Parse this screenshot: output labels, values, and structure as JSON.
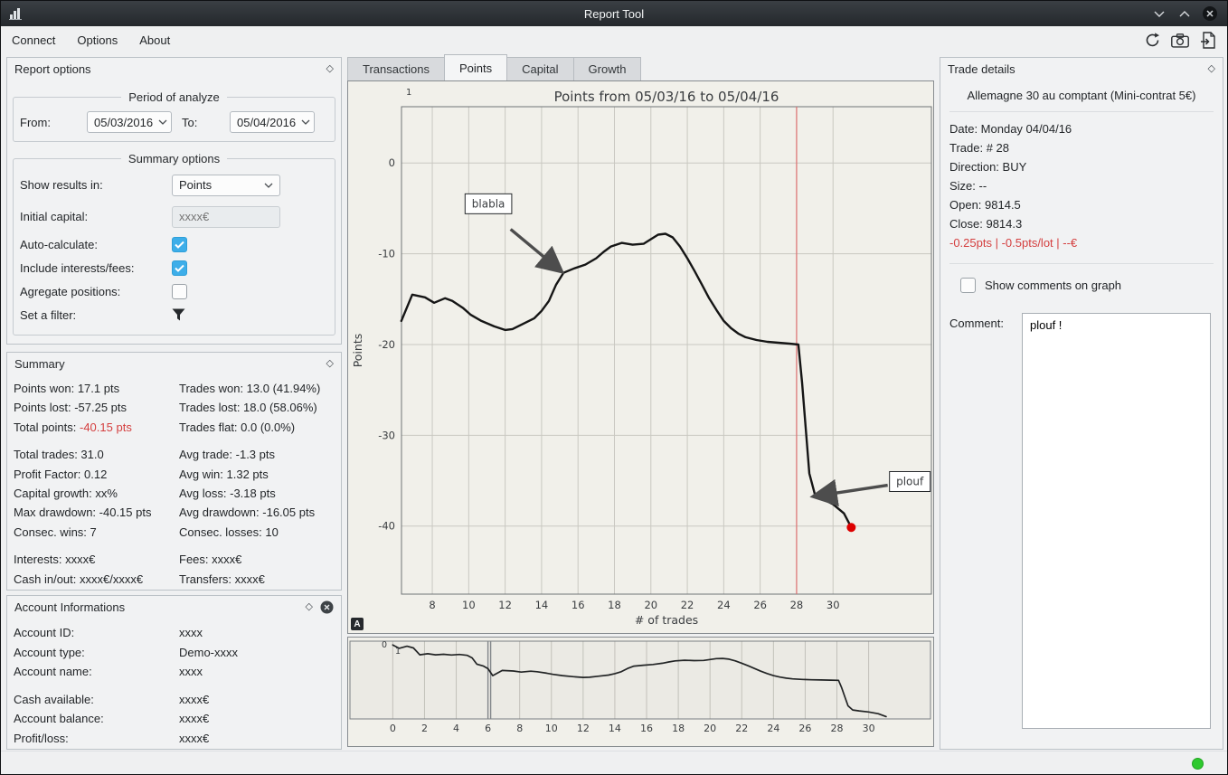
{
  "window": {
    "title": "Report Tool"
  },
  "menu": {
    "items": [
      "Connect",
      "Options",
      "About"
    ]
  },
  "tabs": {
    "items": [
      {
        "label": "Transactions",
        "active": false
      },
      {
        "label": "Points",
        "active": true
      },
      {
        "label": "Capital",
        "active": false
      },
      {
        "label": "Growth",
        "active": false
      }
    ]
  },
  "report_options": {
    "title": "Report options",
    "period": {
      "legend": "Period of analyze",
      "from_label": "From:",
      "from_value": "05/03/2016",
      "to_label": "To:",
      "to_value": "05/04/2016"
    },
    "options": {
      "legend": "Summary options",
      "show_results_label": "Show results in:",
      "show_results_value": "Points",
      "initial_capital_label": "Initial capital:",
      "initial_capital_placeholder": "xxxx€",
      "auto_calculate_label": "Auto-calculate:",
      "auto_calculate_checked": true,
      "include_fees_label": "Include interests/fees:",
      "include_fees_checked": true,
      "aggregate_label": "Agregate positions:",
      "aggregate_checked": false,
      "filter_label": "Set a filter:"
    }
  },
  "summary": {
    "title": "Summary",
    "groups": [
      {
        "rows": [
          {
            "left": "Points won: 17.1 pts",
            "right": "Trades won: 13.0 (41.94%)"
          },
          {
            "left": "Points lost: -57.25 pts",
            "right": "Trades lost: 18.0 (58.06%)"
          },
          {
            "left_label": "Total points: ",
            "left_value": "-40.15 pts",
            "right": "Trades flat: 0.0 (0.0%)"
          }
        ]
      },
      {
        "rows": [
          {
            "left": "Total trades: 31.0",
            "right": "Avg trade: -1.3 pts"
          },
          {
            "left": "Profit Factor: 0.12",
            "right": "Avg win: 1.32 pts"
          },
          {
            "left": "Capital growth: xx%",
            "right": "Avg loss: -3.18 pts"
          },
          {
            "left": "Max drawdown: -40.15 pts",
            "right": "Avg drawdown: -16.05 pts"
          },
          {
            "left": "Consec. wins: 7",
            "right": "Consec. losses: 10"
          }
        ]
      },
      {
        "rows": [
          {
            "left": "Interests: xxxx€",
            "right": "Fees: xxxx€"
          },
          {
            "left": "Cash in/out: xxxx€/xxxx€",
            "right": "Transfers: xxxx€"
          }
        ]
      }
    ]
  },
  "account_info": {
    "title": "Account Informations",
    "rows": [
      {
        "label": "Account ID:",
        "value": "xxxx"
      },
      {
        "label": "Account type:",
        "value": "Demo-xxxx"
      },
      {
        "label": "Account name:",
        "value": "xxxx"
      },
      {
        "label": "Cash available:",
        "value": "xxxx€"
      },
      {
        "label": "Account balance:",
        "value": "xxxx€"
      },
      {
        "label": "Profit/loss:",
        "value": "xxxx€"
      }
    ]
  },
  "trade_details": {
    "title": "Trade details",
    "instrument": "Allemagne 30 au comptant (Mini-contrat 5€)",
    "fields": [
      "Date: Monday 04/04/16",
      "Trade: # 28",
      "Direction: BUY",
      "Size: --",
      "Open: 9814.5",
      "Close: 9814.3"
    ],
    "result": "-0.25pts | -0.5pts/lot | --€",
    "show_comments_label": "Show comments on graph",
    "show_comments_checked": false,
    "comment_label": "Comment:",
    "comment_value": "plouf !"
  },
  "main_chart_badge": "A",
  "colors": {
    "accent": "#3daee9",
    "negative_text": "#d43f3f",
    "line": "#151515",
    "marker": "#dd0000",
    "vline": "#dd7070",
    "grid": "#c9c8c1",
    "status_ok": "#2ec92e"
  },
  "chart_data": [
    {
      "type": "line",
      "title": "Points from 05/03/16 to 05/04/16",
      "xlabel": "# of trades",
      "ylabel": "Points",
      "xlim": [
        6.31,
        35.4
      ],
      "ylim": [
        -47.5,
        6.2
      ],
      "xticks": [
        8,
        10,
        12,
        14,
        16,
        18,
        20,
        22,
        24,
        26,
        28,
        30
      ],
      "yticks": [
        0,
        -10,
        -20,
        -30,
        -40
      ],
      "corner_label": "1",
      "vline": {
        "x": 28,
        "color": "#dd7070"
      },
      "marker": {
        "x": 31,
        "y": -40.15,
        "color": "#dd0000"
      },
      "series": [
        {
          "name": "cumulated points",
          "points": [
            [
              6.3,
              -17.4
            ],
            [
              6.9,
              -14.5
            ],
            [
              7.6,
              -14.8
            ],
            [
              8.1,
              -15.4
            ],
            [
              8.7,
              -14.9
            ],
            [
              9.1,
              -15.2
            ],
            [
              9.7,
              -16.0
            ],
            [
              10.1,
              -16.7
            ],
            [
              10.7,
              -17.4
            ],
            [
              11.4,
              -18.0
            ],
            [
              12.0,
              -18.4
            ],
            [
              12.4,
              -18.3
            ],
            [
              13.0,
              -17.7
            ],
            [
              13.6,
              -17.1
            ],
            [
              14.0,
              -16.3
            ],
            [
              14.4,
              -15.2
            ],
            [
              14.8,
              -13.4
            ],
            [
              15.2,
              -12.1
            ],
            [
              15.8,
              -11.6
            ],
            [
              16.4,
              -11.2
            ],
            [
              17.0,
              -10.5
            ],
            [
              17.4,
              -9.8
            ],
            [
              17.8,
              -9.2
            ],
            [
              18.4,
              -8.8
            ],
            [
              19.0,
              -9.0
            ],
            [
              19.6,
              -8.9
            ],
            [
              20.0,
              -8.4
            ],
            [
              20.4,
              -7.9
            ],
            [
              20.8,
              -7.8
            ],
            [
              21.2,
              -8.2
            ],
            [
              21.6,
              -9.2
            ],
            [
              22.0,
              -10.5
            ],
            [
              22.4,
              -11.9
            ],
            [
              22.8,
              -13.4
            ],
            [
              23.2,
              -14.9
            ],
            [
              23.6,
              -16.2
            ],
            [
              24.0,
              -17.4
            ],
            [
              24.4,
              -18.2
            ],
            [
              24.8,
              -18.8
            ],
            [
              25.2,
              -19.2
            ],
            [
              25.8,
              -19.5
            ],
            [
              26.4,
              -19.7
            ],
            [
              27.0,
              -19.8
            ],
            [
              27.6,
              -19.9
            ],
            [
              28.1,
              -20.0
            ],
            [
              28.3,
              -24.2
            ],
            [
              28.5,
              -29.2
            ],
            [
              28.7,
              -34.2
            ],
            [
              29.0,
              -36.5
            ],
            [
              29.4,
              -37.0
            ],
            [
              30.0,
              -37.6
            ],
            [
              30.6,
              -38.6
            ],
            [
              31.0,
              -40.15
            ]
          ]
        }
      ],
      "annotations": [
        {
          "text": "blabla",
          "box_xy": [
            9.8,
            -3.4
          ],
          "arrow_from": [
            12.3,
            -7.3
          ],
          "arrow_to": [
            15.0,
            -11.8
          ]
        },
        {
          "text": "plouf",
          "box_xy": [
            33.1,
            -34.0
          ],
          "arrow_from": [
            33.0,
            -35.5
          ],
          "arrow_to": [
            29.05,
            -36.7
          ]
        }
      ]
    },
    {
      "type": "line",
      "title": "",
      "xlabel": "",
      "ylabel": "",
      "xlim": [
        -2.7,
        33.9
      ],
      "ylim": [
        -41.5,
        1.8
      ],
      "xticks": [
        0,
        2,
        4,
        6,
        8,
        10,
        12,
        14,
        16,
        18,
        20,
        22,
        24,
        26,
        28,
        30
      ],
      "yticks": [],
      "corner_labels": [
        "0",
        "1"
      ],
      "handles": [
        6.0,
        6.17
      ],
      "series": [
        {
          "name": "cumulated points (overview)",
          "points": [
            [
              0.0,
              -0.3
            ],
            [
              0.4,
              -2.2
            ],
            [
              0.9,
              -1.0
            ],
            [
              1.3,
              -2.0
            ],
            [
              1.7,
              -5.8
            ],
            [
              2.2,
              -5.2
            ],
            [
              2.7,
              -5.8
            ],
            [
              3.2,
              -5.5
            ],
            [
              3.7,
              -5.9
            ],
            [
              4.2,
              -5.6
            ],
            [
              4.7,
              -6.1
            ],
            [
              5.0,
              -7.5
            ],
            [
              5.3,
              -11.0
            ],
            [
              5.7,
              -12.0
            ],
            [
              6.0,
              -13.5
            ],
            [
              6.3,
              -17.4
            ],
            [
              6.9,
              -14.5
            ],
            [
              7.6,
              -14.8
            ],
            [
              8.1,
              -15.4
            ],
            [
              8.7,
              -14.9
            ],
            [
              9.1,
              -15.2
            ],
            [
              9.7,
              -16.0
            ],
            [
              10.1,
              -16.7
            ],
            [
              10.7,
              -17.4
            ],
            [
              11.4,
              -18.0
            ],
            [
              12.0,
              -18.4
            ],
            [
              12.4,
              -18.3
            ],
            [
              13.0,
              -17.7
            ],
            [
              13.6,
              -17.1
            ],
            [
              14.0,
              -16.3
            ],
            [
              14.4,
              -15.2
            ],
            [
              14.8,
              -13.4
            ],
            [
              15.2,
              -12.1
            ],
            [
              15.8,
              -11.6
            ],
            [
              16.4,
              -11.2
            ],
            [
              17.0,
              -10.5
            ],
            [
              17.4,
              -9.8
            ],
            [
              17.8,
              -9.2
            ],
            [
              18.4,
              -8.8
            ],
            [
              19.0,
              -9.0
            ],
            [
              19.6,
              -8.9
            ],
            [
              20.0,
              -8.4
            ],
            [
              20.4,
              -7.9
            ],
            [
              20.8,
              -7.8
            ],
            [
              21.2,
              -8.2
            ],
            [
              21.6,
              -9.2
            ],
            [
              22.0,
              -10.5
            ],
            [
              22.4,
              -11.9
            ],
            [
              22.8,
              -13.4
            ],
            [
              23.2,
              -14.9
            ],
            [
              23.6,
              -16.2
            ],
            [
              24.0,
              -17.4
            ],
            [
              24.4,
              -18.2
            ],
            [
              24.8,
              -18.8
            ],
            [
              25.2,
              -19.2
            ],
            [
              25.8,
              -19.5
            ],
            [
              26.4,
              -19.7
            ],
            [
              27.0,
              -19.8
            ],
            [
              27.6,
              -19.9
            ],
            [
              28.1,
              -20.0
            ],
            [
              28.3,
              -24.2
            ],
            [
              28.5,
              -29.2
            ],
            [
              28.7,
              -34.2
            ],
            [
              29.0,
              -36.5
            ],
            [
              29.4,
              -37.0
            ],
            [
              30.0,
              -37.6
            ],
            [
              30.6,
              -38.6
            ],
            [
              31.1,
              -40.2
            ]
          ]
        }
      ]
    }
  ]
}
